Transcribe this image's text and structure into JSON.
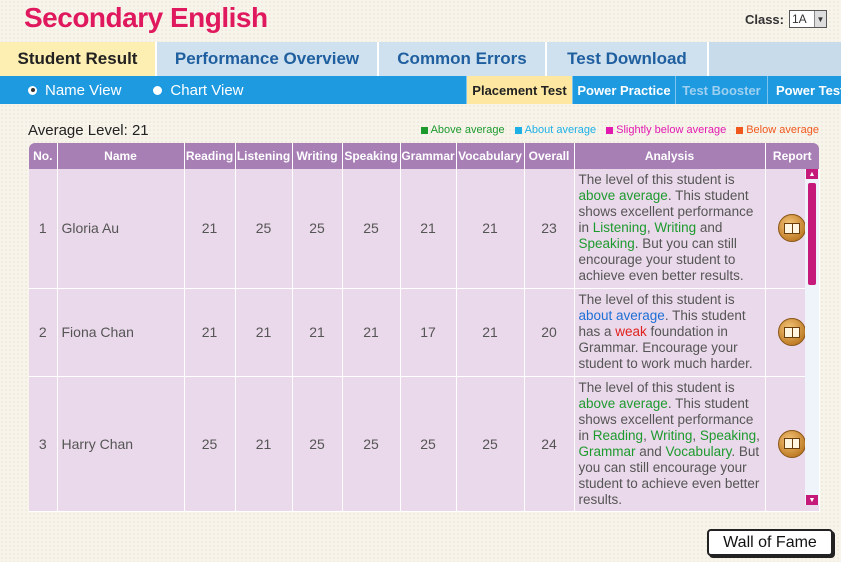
{
  "app_title": "Secondary English",
  "class_picker": {
    "label": "Class:",
    "selected": "1A"
  },
  "main_tabs": [
    {
      "label": "Student Result",
      "active": true
    },
    {
      "label": "Performance Overview",
      "active": false
    },
    {
      "label": "Common Errors",
      "active": false
    },
    {
      "label": "Test Download",
      "active": false
    }
  ],
  "view_options": [
    {
      "label": "Name View",
      "selected": true
    },
    {
      "label": "Chart View",
      "selected": false
    }
  ],
  "test_tabs": [
    {
      "label": "Placement Test",
      "state": "active"
    },
    {
      "label": "Power Practice",
      "state": "normal"
    },
    {
      "label": "Test Booster",
      "state": "muted"
    },
    {
      "label": "Power Test",
      "state": "normal"
    }
  ],
  "average_level": "Average Level: 21",
  "legend": [
    {
      "label": "Above average",
      "color": "#1d9a2e"
    },
    {
      "label": "About average",
      "color": "#1db0e6"
    },
    {
      "label": "Slightly below average",
      "color": "#e21ab0"
    },
    {
      "label": "Below average",
      "color": "#f0581d"
    }
  ],
  "table": {
    "headers": [
      "No.",
      "Name",
      "Reading",
      "Listening",
      "Writing",
      "Speaking",
      "Grammar",
      "Vocabulary",
      "Overall",
      "Analysis",
      "Report"
    ],
    "rows": [
      {
        "no": "1",
        "name": "Gloria Au",
        "reading": "21",
        "listening": "25",
        "writing": "25",
        "speaking": "25",
        "grammar": "21",
        "vocabulary": "21",
        "overall": "23",
        "analysis": [
          {
            "t": "The level of this student is ",
            "c": ""
          },
          {
            "t": "above average",
            "c": "above"
          },
          {
            "t": ". This student shows excellent performance in ",
            "c": ""
          },
          {
            "t": "Listening",
            "c": "above"
          },
          {
            "t": ", ",
            "c": ""
          },
          {
            "t": "Writing",
            "c": "above"
          },
          {
            "t": " and ",
            "c": ""
          },
          {
            "t": "Speaking",
            "c": "above"
          },
          {
            "t": ". But you can still encourage your student to achieve even better results.",
            "c": ""
          }
        ]
      },
      {
        "no": "2",
        "name": "Fiona Chan",
        "reading": "21",
        "listening": "21",
        "writing": "21",
        "speaking": "21",
        "grammar": "17",
        "vocabulary": "21",
        "overall": "20",
        "analysis": [
          {
            "t": "The level of this student is ",
            "c": ""
          },
          {
            "t": "about average",
            "c": "about"
          },
          {
            "t": ". This student has a ",
            "c": ""
          },
          {
            "t": "weak",
            "c": "below"
          },
          {
            "t": " foundation in Grammar. Encourage your student to work much harder.",
            "c": ""
          }
        ]
      },
      {
        "no": "3",
        "name": "Harry Chan",
        "reading": "25",
        "listening": "21",
        "writing": "25",
        "speaking": "25",
        "grammar": "25",
        "vocabulary": "25",
        "overall": "24",
        "analysis": [
          {
            "t": "The level of this student is ",
            "c": ""
          },
          {
            "t": "above average",
            "c": "above"
          },
          {
            "t": ". This student shows excellent performance in ",
            "c": ""
          },
          {
            "t": "Reading",
            "c": "above"
          },
          {
            "t": ", ",
            "c": ""
          },
          {
            "t": "Writing",
            "c": "above"
          },
          {
            "t": ", ",
            "c": ""
          },
          {
            "t": "Speaking",
            "c": "above"
          },
          {
            "t": ", ",
            "c": ""
          },
          {
            "t": "Grammar",
            "c": "above"
          },
          {
            "t": " and ",
            "c": ""
          },
          {
            "t": "Vocabulary",
            "c": "above"
          },
          {
            "t": ". But you can still encourage your student to achieve even better results.",
            "c": ""
          }
        ]
      }
    ]
  },
  "wall_of_fame": "Wall of Fame"
}
